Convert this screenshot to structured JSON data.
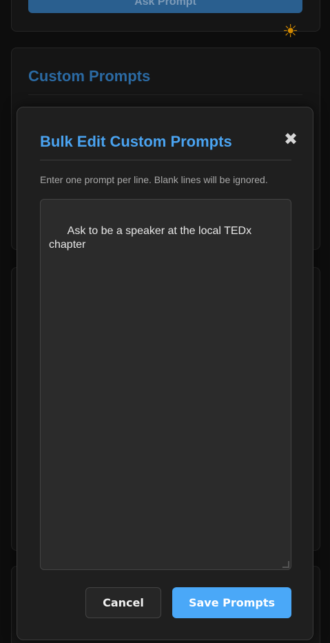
{
  "background": {
    "top_button_label": "Ask Prompt",
    "custom_section_title": "Custom Prompts",
    "theme_icon": "sun-icon"
  },
  "modal": {
    "title": "Bulk Edit Custom Prompts",
    "close_icon": "close-icon",
    "close_glyph": "✖",
    "helper_text": "Enter one prompt per line. Blank lines will be ignored.",
    "textarea_value": "Ask to be a speaker at the local TEDx chapter",
    "cancel_label": "Cancel",
    "save_label": "Save Prompts"
  },
  "colors": {
    "accent": "#4aa8f8",
    "title_blue": "#4aa3f0",
    "modal_bg": "#1f1f1f",
    "page_bg": "#0d0d0d"
  }
}
